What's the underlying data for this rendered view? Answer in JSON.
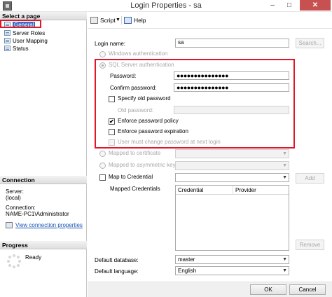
{
  "window": {
    "title": "Login Properties - sa",
    "minimize": "–",
    "maximize": "□",
    "close": "✕"
  },
  "left_pane": {
    "select_page_header": "Select a page",
    "pages": [
      {
        "label": "General",
        "selected": true,
        "icon": "page-icon"
      },
      {
        "label": "Server Roles",
        "icon": "page-icon"
      },
      {
        "label": "User Mapping",
        "icon": "page-icon"
      },
      {
        "label": "Status",
        "icon": "page-icon"
      }
    ],
    "connection_header": "Connection",
    "server_label": "Server:",
    "server_value": "(local)",
    "connection_label": "Connection:",
    "connection_value": "NAME-PC1\\Administrator",
    "view_connection_link": "View connection properties",
    "progress_header": "Progress",
    "progress_status": "Ready"
  },
  "toolbar": {
    "script_label": "Script",
    "script_icon": "script-icon",
    "help_label": "Help",
    "help_icon": "help-icon",
    "dropdown_arrow": "▼"
  },
  "form": {
    "login_name_label": "Login name:",
    "login_name_value": "sa",
    "search_button": "Search...",
    "windows_auth_label": "Windows authentication",
    "sql_auth_label": "SQL Server authentication",
    "password_label": "Password:",
    "password_value": "●●●●●●●●●●●●●●●",
    "confirm_password_label": "Confirm password:",
    "confirm_password_value": "●●●●●●●●●●●●●●●",
    "specify_old_password_label": "Specify old password",
    "old_password_label": "Old password:",
    "enforce_policy_label": "Enforce password policy",
    "enforce_policy_checked": true,
    "check_mark": "✔",
    "enforce_expiration_label": "Enforce password expiration",
    "must_change_label": "User must change password at next login",
    "mapped_certificate_label": "Mapped to certificate",
    "mapped_asymmetric_label": "Mapped to asymmetric key",
    "map_credential_label": "Map to Credential",
    "add_button": "Add",
    "mapped_credentials_label": "Mapped Credentials",
    "credentials_columns": [
      "Credential",
      "Provider"
    ],
    "remove_button": "Remove",
    "default_database_label": "Default database:",
    "default_database_value": "master",
    "default_language_label": "Default language:",
    "default_language_value": "English",
    "select_arrow": "▼"
  },
  "buttons": {
    "ok": "OK",
    "cancel": "Cancel"
  },
  "colors": {
    "highlight_red": "#e0162b",
    "selection_blue": "#3f6bbf",
    "link_blue": "#1a56b6"
  }
}
